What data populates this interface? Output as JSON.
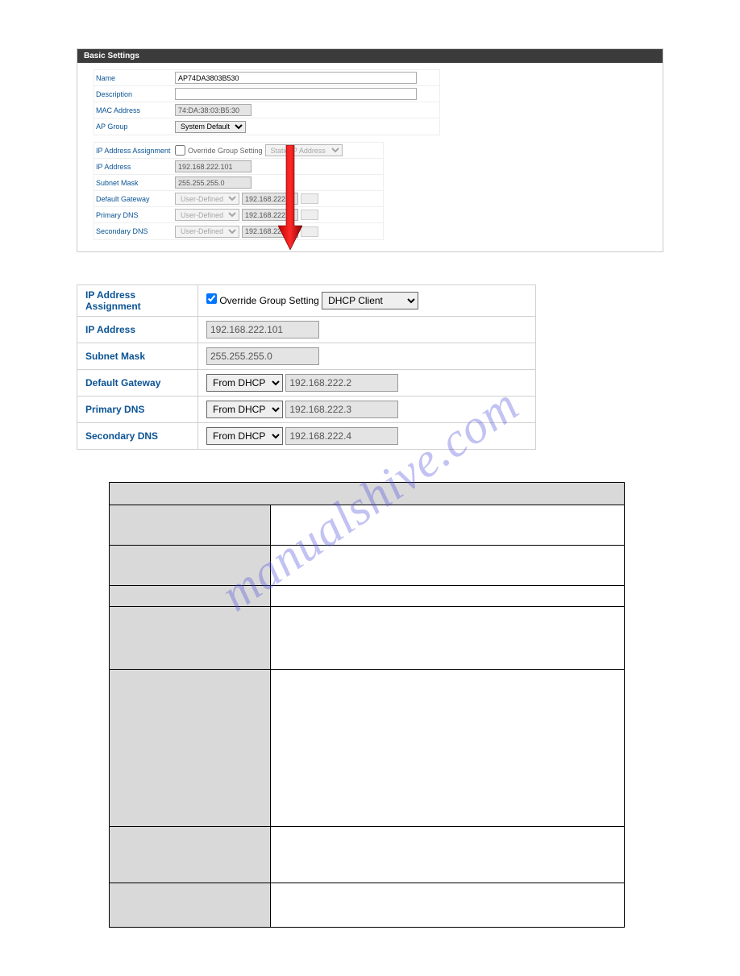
{
  "panel": {
    "title": "Basic Settings"
  },
  "basic": {
    "name_label": "Name",
    "name_value": "AP74DA3803B530",
    "description_label": "Description",
    "description_value": "",
    "mac_label": "MAC Address",
    "mac_value": "74:DA:38:03:B5:30",
    "apgroup_label": "AP Group",
    "apgroup_value": "System Default"
  },
  "net1": {
    "ipassign_label": "IP Address Assignment",
    "override_label": "Override Group Setting",
    "override_checked": false,
    "mode_value": "Static IP Address",
    "ip_label": "IP Address",
    "ip_value": "192.168.222.101",
    "mask_label": "Subnet Mask",
    "mask_value": "255.255.255.0",
    "gw_label": "Default Gateway",
    "gw_mode": "User-Defined",
    "gw_value": "192.168.222.2",
    "pdns_label": "Primary DNS",
    "pdns_mode": "User-Defined",
    "pdns_value": "192.168.222.3",
    "sdns_label": "Secondary DNS",
    "sdns_mode": "User-Defined",
    "sdns_value": "192.168.222.4"
  },
  "net2": {
    "ipassign_label": "IP Address Assignment",
    "override_label": "Override Group Setting",
    "override_checked": true,
    "mode_value": "DHCP Client",
    "ip_label": "IP Address",
    "ip_value": "192.168.222.101",
    "mask_label": "Subnet Mask",
    "mask_value": "255.255.255.0",
    "gw_label": "Default Gateway",
    "gw_mode": "From DHCP",
    "gw_value": "192.168.222.2",
    "pdns_label": "Primary DNS",
    "pdns_mode": "From DHCP",
    "pdns_value": "192.168.222.3",
    "sdns_label": "Secondary DNS",
    "sdns_mode": "From DHCP",
    "sdns_value": "192.168.222.4"
  },
  "watermark": "manualshive.com"
}
